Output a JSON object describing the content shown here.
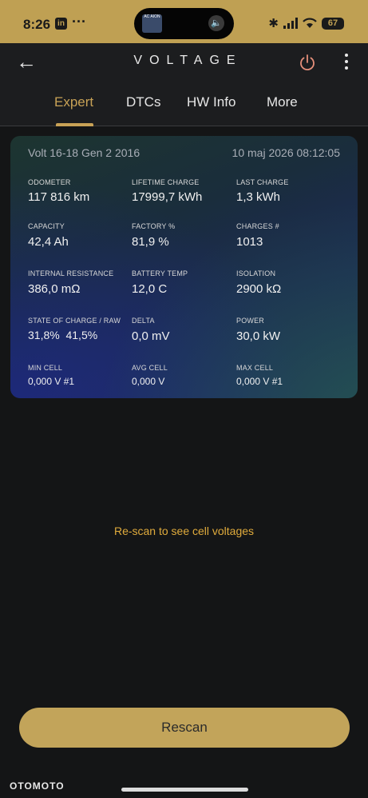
{
  "status_bar": {
    "time": "8:26",
    "linkedin": "in",
    "dots": "···",
    "island_thumb_text": "AC AION",
    "battery": "67"
  },
  "app_bar": {
    "title": "VOLTAGE",
    "back_icon": "arrow-left-icon",
    "power_icon": "power-icon",
    "menu_icon": "more-vertical-icon"
  },
  "tabs": [
    {
      "label": "Expert",
      "active": true
    },
    {
      "label": "DTCs",
      "active": false
    },
    {
      "label": "HW Info",
      "active": false
    },
    {
      "label": "More",
      "active": false
    }
  ],
  "card": {
    "vehicle": "Volt 16-18 Gen 2 2016",
    "datetime": "10 maj 2026 08:12:05",
    "metrics": [
      {
        "label": "ODOMETER",
        "value": "117 816 km"
      },
      {
        "label": "LIFETIME CHARGE",
        "value": "17999,7 kWh"
      },
      {
        "label": "LAST CHARGE",
        "value": "1,3 kWh"
      },
      {
        "label": "CAPACITY",
        "value": "42,4 Ah"
      },
      {
        "label": "FACTORY %",
        "value": "81,9 %"
      },
      {
        "label": "CHARGES #",
        "value": "1013"
      },
      {
        "label": "INTERNAL RESISTANCE",
        "value": "386,0 mΩ"
      },
      {
        "label": "BATTERY TEMP",
        "value": "12,0 C"
      },
      {
        "label": "ISOLATION",
        "value": "2900 kΩ"
      },
      {
        "label": "STATE OF CHARGE / RAW",
        "value": "31,8%  41,5%"
      },
      {
        "label": "DELTA",
        "value": "0,0 mV"
      },
      {
        "label": "POWER",
        "value": "30,0 kW"
      },
      {
        "label": "MIN CELL",
        "value": "0,000 V #1"
      },
      {
        "label": "AVG CELL",
        "value": "0,000 V"
      },
      {
        "label": "MAX CELL",
        "value": "0,000 V #1"
      }
    ]
  },
  "hint": "Re-scan to see cell voltages",
  "rescan_label": "Rescan",
  "watermark": "OTOMOTO",
  "colors": {
    "accent": "#c8a256",
    "status_bar": "#bfa053",
    "hint": "#e0ab3c",
    "power_icon": "#e58f7a"
  }
}
